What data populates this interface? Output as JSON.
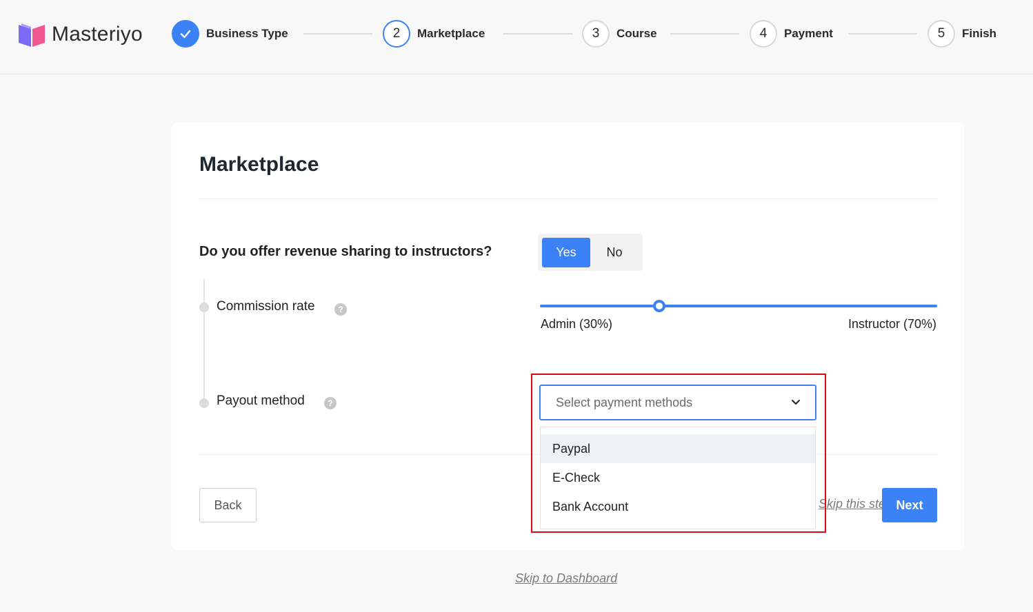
{
  "brand": {
    "name": "Masteriyo"
  },
  "steps": [
    {
      "number": "",
      "label": "Business Type",
      "state": "done"
    },
    {
      "number": "2",
      "label": "Marketplace",
      "state": "active"
    },
    {
      "number": "3",
      "label": "Course",
      "state": "pending"
    },
    {
      "number": "4",
      "label": "Payment",
      "state": "pending"
    },
    {
      "number": "5",
      "label": "Finish",
      "state": "pending"
    }
  ],
  "card": {
    "title": "Marketplace",
    "question": "Do you offer revenue sharing to instructors?",
    "toggle": {
      "yes": "Yes",
      "no": "No",
      "selected": "Yes"
    },
    "commission": {
      "label": "Commission rate",
      "admin_label": "Admin (30%)",
      "instructor_label": "Instructor (70%)",
      "admin_percent": 30
    },
    "payout": {
      "label": "Payout method",
      "placeholder": "Select payment methods",
      "options": [
        "Paypal",
        "E-Check",
        "Bank Account"
      ],
      "highlighted": "Paypal"
    },
    "back_label": "Back",
    "skip_step_label": "Skip this step",
    "next_label": "Next"
  },
  "skip_dashboard_label": "Skip to Dashboard",
  "colors": {
    "accent": "#3b82f6",
    "highlight_border": "#e30613"
  }
}
